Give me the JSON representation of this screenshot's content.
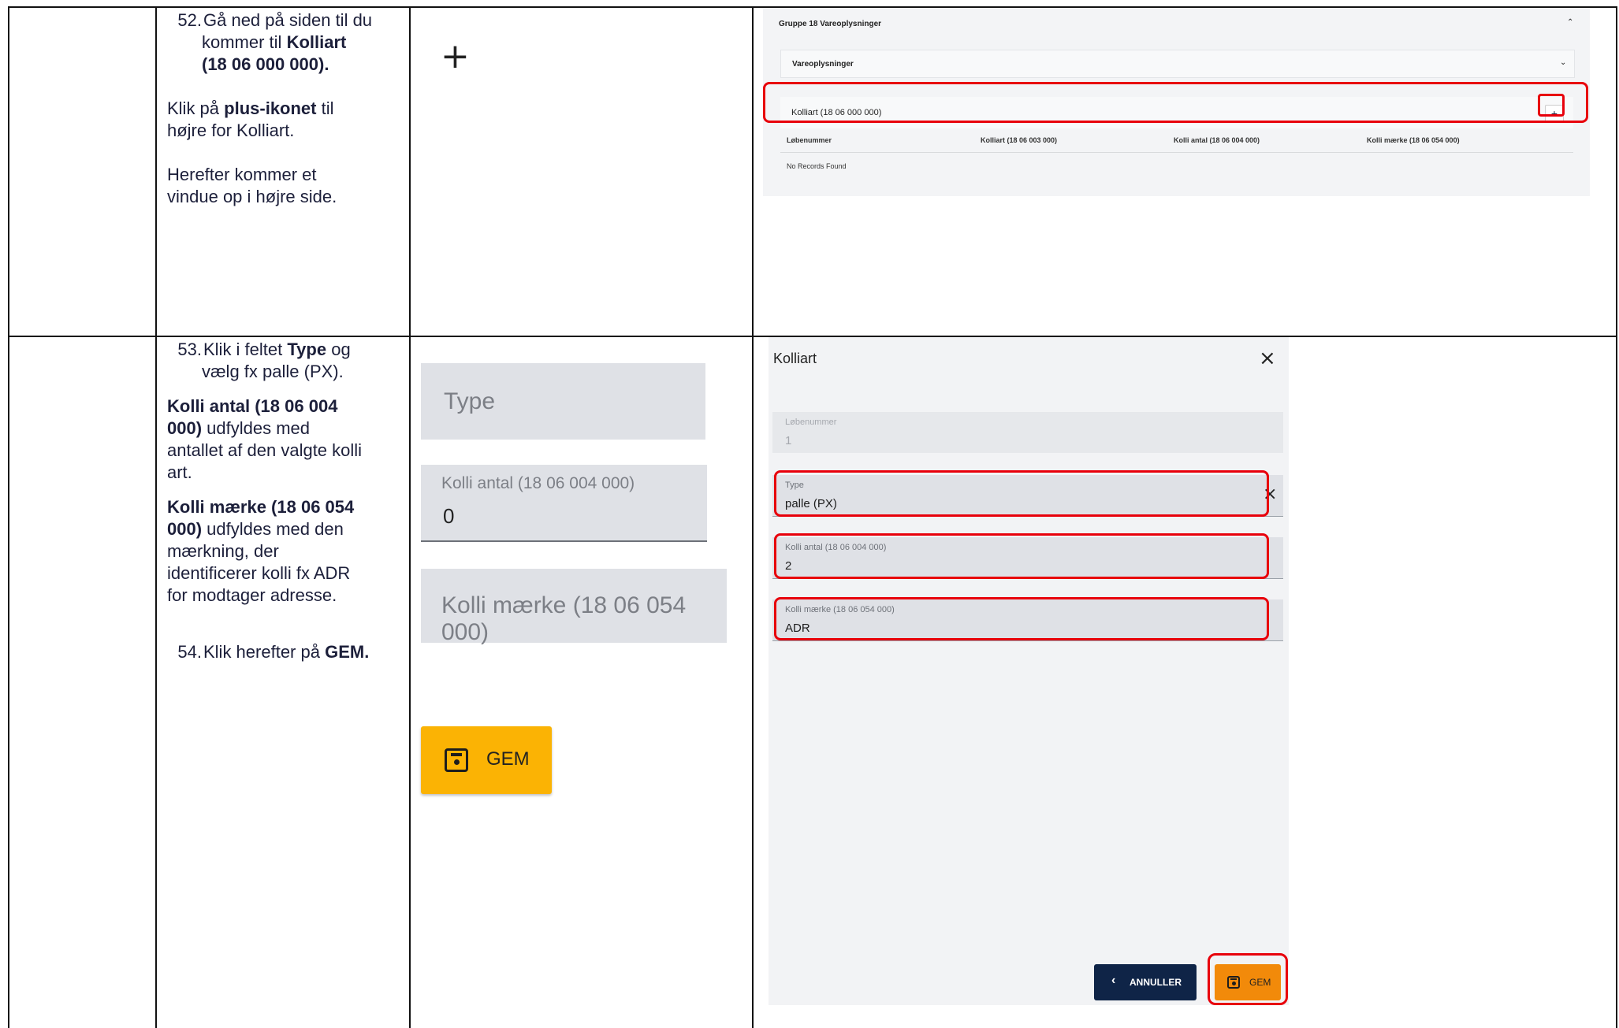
{
  "row1": {
    "step_num": "52.",
    "line1": "Gå ned på siden til du",
    "line2_pre": "kommer til ",
    "line2_bold": "Kolliart",
    "line3_bold": "(18 06 000 000).",
    "p2_pre": "Klik på ",
    "p2_bold": "plus-ikonet",
    "p2_post": " til",
    "p2_line2": "højre for Kolliart.",
    "p3_line1": "Herefter kommer et",
    "p3_line2": "vindue op i højre side.",
    "plus_symbol": "+"
  },
  "screenshot1": {
    "group_title": "Gruppe 18 Vareoplysninger",
    "sub_section": "Vareoplysninger",
    "kolliart_label": "Kolliart (18 06 000 000)",
    "add_symbol": "+",
    "columns": [
      "Løbenummer",
      "Kolliart (18 06 003 000)",
      "Kolli antal (18 06 004 000)",
      "Kolli mærke (18 06 054 000)"
    ],
    "empty_text": "No Records Found"
  },
  "row2": {
    "step53_num": "53.",
    "s53_pre": "Klik i feltet ",
    "s53_bold": "Type",
    "s53_post": " og",
    "s53_line2": "vælg fx palle (PX).",
    "antal_bold1": "Kolli antal (18 06 004",
    "antal_bold2": "000)",
    "antal_post": " udfyldes med",
    "antal_line3": "antallet af den valgte kolli",
    "antal_line4": "art.",
    "maerke_bold1": "Kolli mærke (18 06 054",
    "maerke_bold2": "000)",
    "maerke_post": " udfyldes med den",
    "maerke_line3": "mærkning, der",
    "maerke_line4": "identificerer kolli fx ADR",
    "maerke_line5": "for modtager adresse.",
    "step54_num": "54.",
    "s54_pre": "Klik herefter på ",
    "s54_bold": "GEM."
  },
  "crops": {
    "type_placeholder": "Type",
    "antal_label": "Kolli antal (18 06 004 000)",
    "antal_value": "0",
    "maerke_placeholder": "Kolli mærke (18 06 054 000)",
    "gem_label": "GEM"
  },
  "dialog": {
    "title": "Kolliart",
    "close_symbol": "×",
    "loebenummer_label": "Løbenummer",
    "loebenummer_value": "1",
    "type_label": "Type",
    "type_value": "palle (PX)",
    "clear_symbol": "×",
    "antal_label": "Kolli antal (18 06 004 000)",
    "antal_value": "2",
    "maerke_label": "Kolli mærke (18 06 054 000)",
    "maerke_value": "ADR",
    "cancel_label": "ANNULLER",
    "save_label": "GEM"
  },
  "colors": {
    "highlight": "#e8000b",
    "gem_yellow": "#fbb304",
    "gem_orange": "#f28a0a",
    "navy": "#0f2447"
  }
}
